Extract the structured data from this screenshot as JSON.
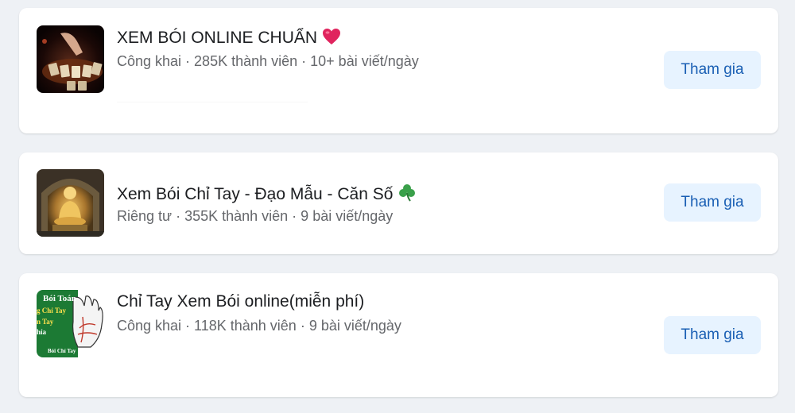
{
  "groups": [
    {
      "name": "XEM BÓI ONLINE CHUẨN",
      "meta": "Công khai · 285K thành viên · 10+ bài viết/ngày",
      "emoji_icon": "red-heart-icon",
      "thumbnail_icon": "tarot-cards-image",
      "button_label": "Tham gia"
    },
    {
      "name": "Xem Bói Chỉ Tay - Đạo Mẫu - Căn Số",
      "meta": "Riêng tư · 355K thành viên · 9 bài viết/ngày",
      "emoji_icon": "shamrock-icon",
      "thumbnail_icon": "golden-buddha-image",
      "button_label": "Tham gia"
    },
    {
      "name": "Chỉ Tay Xem Bói online(miễn phí)",
      "meta": "Công khai · 118K thành viên · 9 bài viết/ngày",
      "thumbnail_icon": "palm-reading-image",
      "thumbnail_text": {
        "line1": "Bói Toán",
        "line2": "g Chỉ Tay",
        "line3": "n Tay",
        "line4": "hỉa",
        "line5": "Bói Chỉ Tay"
      },
      "button_label": "Tham gia"
    }
  ],
  "colors": {
    "page_background": "#eef1f5",
    "card_background": "#ffffff",
    "button_background": "#e7f3ff",
    "button_text": "#1a5fb4",
    "meta_text": "#65676b"
  }
}
